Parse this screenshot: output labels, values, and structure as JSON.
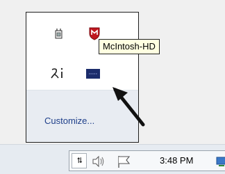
{
  "flyout": {
    "icons": [
      {
        "name": "power-plug-icon"
      },
      {
        "name": "mcafee-shield-icon"
      },
      {
        "name": "ime-language-icon"
      },
      {
        "name": "mcintosh-hd-drive-icon"
      }
    ],
    "customize_label": "Customize..."
  },
  "tooltip": {
    "text": "McIntosh-HD"
  },
  "taskbar": {
    "chevron_label": "⮁",
    "clock": "3:48 PM"
  },
  "colors": {
    "tooltip_bg": "#ffffe1",
    "link": "#1e3f8a",
    "mcafee_red": "#c0161e",
    "drive_blue": "#1b2c6b"
  }
}
